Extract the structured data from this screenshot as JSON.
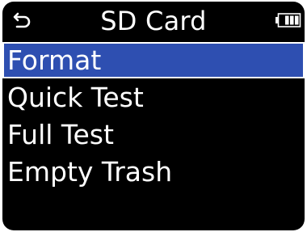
{
  "header": {
    "title": "SD Card",
    "back_icon": "back-arrow-icon",
    "battery_icon": "battery-icon",
    "battery_level": 0.75
  },
  "menu": {
    "selected_index": 0,
    "items": [
      {
        "label": "Format"
      },
      {
        "label": "Quick Test"
      },
      {
        "label": "Full Test"
      },
      {
        "label": "Empty Trash"
      }
    ]
  },
  "colors": {
    "background": "#000000",
    "text": "#ffffff",
    "highlight": "#2e4fb1"
  }
}
